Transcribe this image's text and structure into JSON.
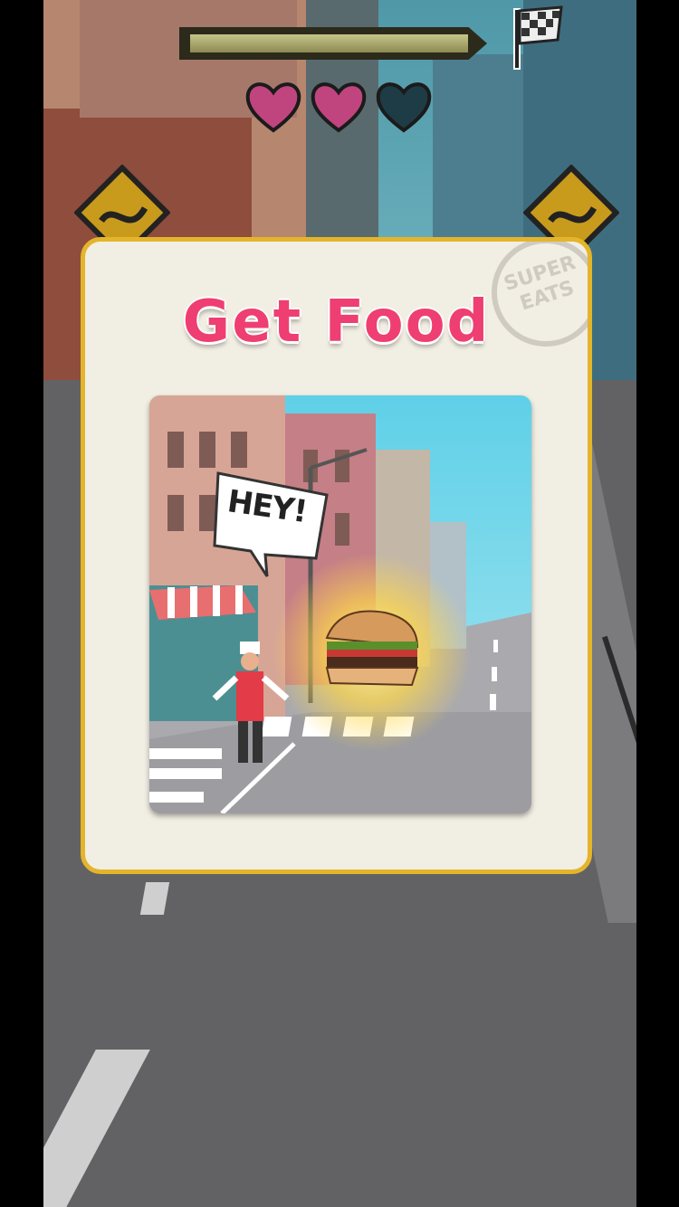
{
  "hud": {
    "progress": 0.93,
    "lives_total": 3,
    "lives_remaining": 2,
    "heart_full_color": "#c0457f",
    "heart_empty_color": "#1e3c45"
  },
  "tutorial": {
    "title": "Get Food",
    "stamp_text": "SUPER EATS",
    "illustration": {
      "speech_bubble": "HEY!"
    }
  },
  "colors": {
    "title": "#ef3e72",
    "card_border": "#e4b42b",
    "card_bg": "#f1eee3"
  }
}
